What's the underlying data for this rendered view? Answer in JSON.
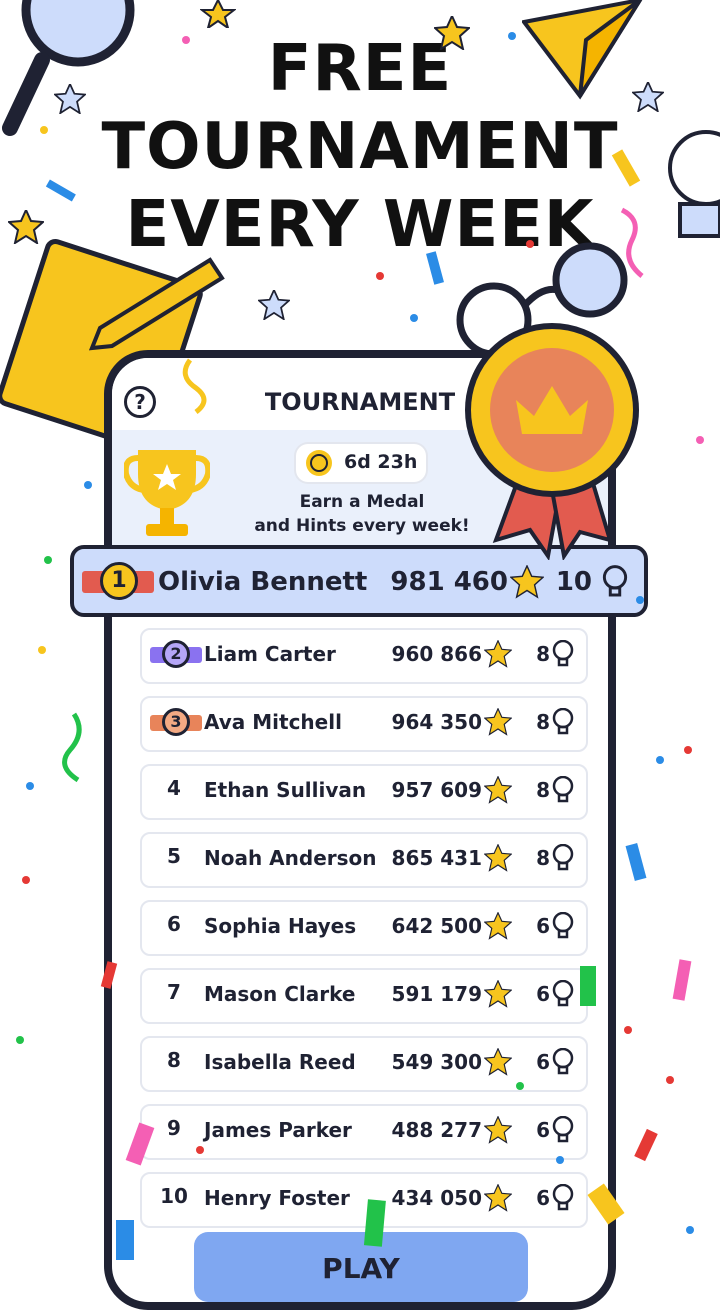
{
  "headline": {
    "line1": "FREE",
    "line2": "TOURNAMENT",
    "line3": "EVERY WEEK"
  },
  "header": {
    "help": "?",
    "title": "TOURNAMENT"
  },
  "banner": {
    "timer": "6d 23h",
    "earn_line1": "Earn a Medal",
    "earn_line2": "and Hints every week!"
  },
  "current_player": {
    "rank": "1",
    "name": "Olivia Bennett",
    "score": "981 460",
    "hints": "10"
  },
  "leaderboard": [
    {
      "rank": "2",
      "name": "Liam Carter",
      "score": "960 866",
      "hints": "8"
    },
    {
      "rank": "3",
      "name": "Ava Mitchell",
      "score": "964 350",
      "hints": "8"
    },
    {
      "rank": "4",
      "name": "Ethan Sullivan",
      "score": "957 609",
      "hints": "8"
    },
    {
      "rank": "5",
      "name": "Noah Anderson",
      "score": "865 431",
      "hints": "8"
    },
    {
      "rank": "6",
      "name": "Sophia Hayes",
      "score": "642 500",
      "hints": "6"
    },
    {
      "rank": "7",
      "name": "Mason Clarke",
      "score": "591 179",
      "hints": "6"
    },
    {
      "rank": "8",
      "name": "Isabella Reed",
      "score": "549 300",
      "hints": "6"
    },
    {
      "rank": "9",
      "name": "James Parker",
      "score": "488 277",
      "hints": "6"
    },
    {
      "rank": "10",
      "name": "Henry Foster",
      "score": "434 050",
      "hints": "6"
    }
  ],
  "play_button": "PLAY",
  "colors": {
    "gold": "#f7c51e",
    "silver_purple": "#8a72f0",
    "bronze": "#e8845a",
    "highlight": "#cddcfb",
    "dark": "#1f2233",
    "play": "#7fa7f1"
  }
}
